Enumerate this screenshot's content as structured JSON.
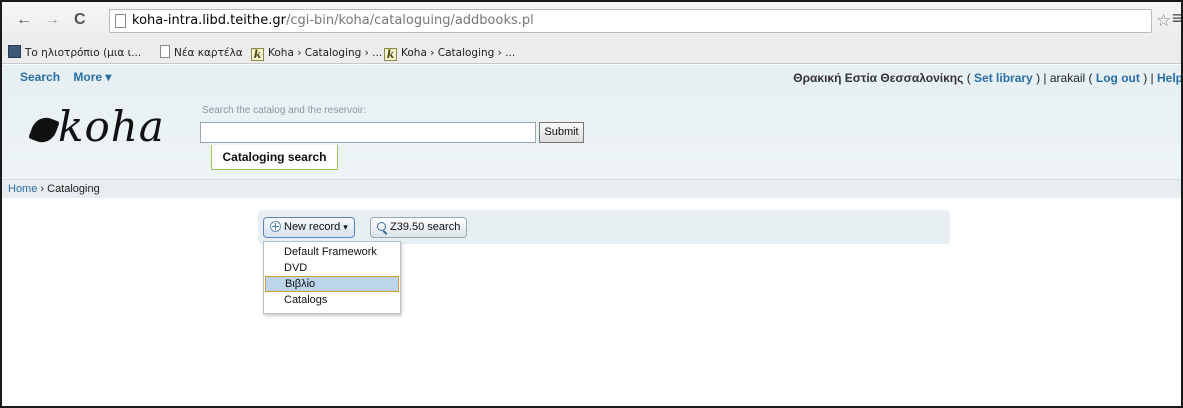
{
  "browser": {
    "url_host": "koha-intra.libd.teithe.gr",
    "url_path": "/cgi-bin/koha/cataloguing/addbooks.pl",
    "nav_back": "←",
    "nav_forward": "→",
    "reload": "C",
    "star": "☆",
    "menu": "≡"
  },
  "bookmarks": [
    {
      "label": "Το ηλιοτρόπιο (μια ι...",
      "icon": "image-icon"
    },
    {
      "label": "Νέα καρτέλα",
      "icon": "page-icon"
    },
    {
      "label": "Koha › Cataloging › ...",
      "icon": "koha-icon",
      "icon_glyph": "k"
    },
    {
      "label": "Koha › Cataloging › ...",
      "icon": "koha-icon",
      "icon_glyph": "k"
    }
  ],
  "header": {
    "nav_search": "Search",
    "nav_more": "More ▾",
    "library": "Θρακική Εστία Θεσσαλονίκης",
    "open_paren": " ( ",
    "set_library": "Set library",
    "after_set": " ) | arakail ( ",
    "log_out": "Log out",
    "after_logout": " ) | ",
    "help": "Help"
  },
  "logo": {
    "text": "koha"
  },
  "search": {
    "label": "Search the catalog and the reservoir:",
    "value": "",
    "submit": "Submit",
    "tab": "Cataloging search"
  },
  "breadcrumb": {
    "home": "Home",
    "separator": " › ",
    "current": "Cataloging"
  },
  "toolbar": {
    "new_record": "New record",
    "new_record_caret": "▾",
    "z3950": "Z39.50 search"
  },
  "dropdown": {
    "items": [
      "Default Framework",
      "DVD",
      "Βιβλίο",
      "Catalogs"
    ],
    "selected_index": 2
  },
  "colors": {
    "link": "#2a6ea8",
    "header_bg": "#e6eff3",
    "selected_bg": "#bcd4ec",
    "selected_border": "#d49a3a",
    "search_tab_border": "#9bc65a"
  }
}
